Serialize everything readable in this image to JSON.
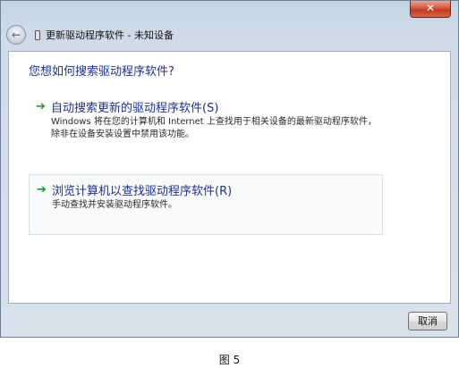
{
  "window": {
    "title": "更新驱动程序软件 - 未知设备",
    "close_label": "✕"
  },
  "main": {
    "heading": "您想如何搜索驱动程序软件?",
    "options": [
      {
        "title": "自动搜索更新的驱动程序软件(S)",
        "description": "Windows 将在您的计算机和 Internet 上查找用于相关设备的最新驱动程序软件，除非在设备安装设置中禁用该功能。"
      },
      {
        "title": "浏览计算机以查找驱动程序软件(R)",
        "description": "手动查找并安装驱动程序软件。"
      }
    ]
  },
  "footer": {
    "cancel_label": "取消"
  },
  "caption": "图 5",
  "icons": {
    "back": "back-arrow-icon",
    "device": "device-icon",
    "option_arrow": "green-arrow-icon"
  },
  "colors": {
    "heading": "#1e3287",
    "arrow": "#1f9a2c",
    "close": "#c0391f"
  }
}
